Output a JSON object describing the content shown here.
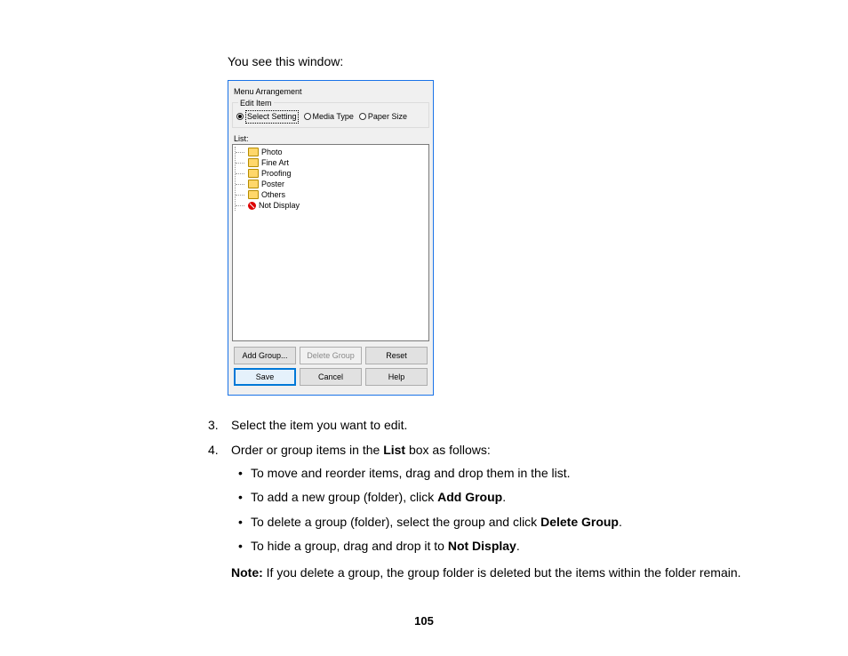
{
  "intro": "You see this window:",
  "dialog": {
    "title": "Menu Arrangement",
    "group_caption": "Edit Item",
    "radios": {
      "select_setting": "Select Setting",
      "media_type": "Media Type",
      "paper_size": "Paper Size"
    },
    "list_label": "List:",
    "items": {
      "photo": "Photo",
      "fine_art": "Fine Art",
      "proofing": "Proofing",
      "poster": "Poster",
      "others": "Others",
      "not_display": "Not Display"
    },
    "buttons": {
      "add_group": "Add Group...",
      "delete_group": "Delete Group",
      "reset": "Reset",
      "save": "Save",
      "cancel": "Cancel",
      "help": "Help"
    }
  },
  "steps": {
    "s3_num": "3.",
    "s3": "Select the item you want to edit.",
    "s4_num": "4.",
    "s4_lead": "Order or group items in the ",
    "s4_bold": "List",
    "s4_tail": " box as follows:",
    "b1": "To move and reorder items, drag and drop them in the list.",
    "b2_lead": "To add a new group (folder), click ",
    "b2_bold": "Add Group",
    "b2_tail": ".",
    "b3_lead": "To delete a group (folder), select the group and click ",
    "b3_bold": "Delete Group",
    "b3_tail": ".",
    "b4_lead": "To hide a group, drag and drop it to ",
    "b4_bold": "Not Display",
    "b4_tail": ".",
    "note_label": "Note:",
    "note_text": " If you delete a group, the group folder is deleted but the items within the folder remain."
  },
  "page_number": "105"
}
